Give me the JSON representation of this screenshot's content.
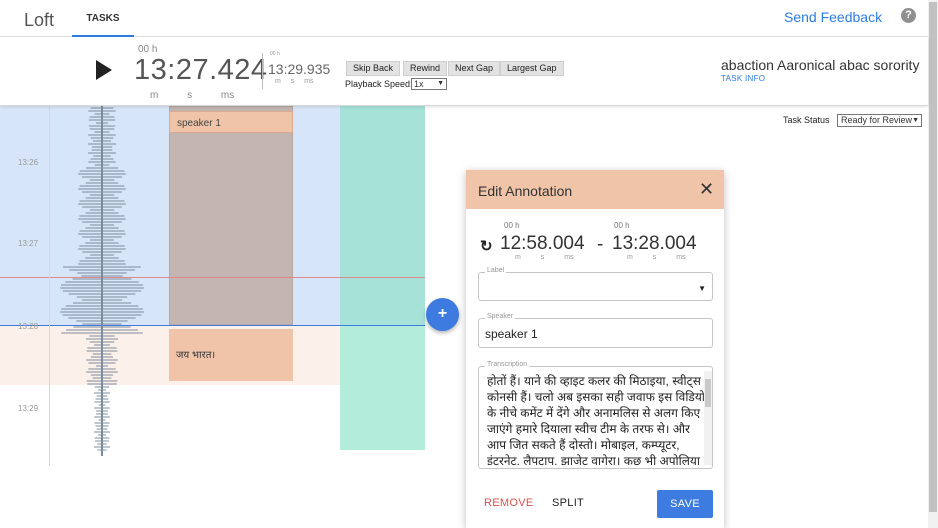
{
  "app": {
    "brand": "Loft",
    "tab_tasks": "TASKS",
    "feedback": "Send Feedback",
    "help_icon": "?"
  },
  "player": {
    "current": {
      "hours": "00 h",
      "time": "13:27.424",
      "units": "m s ms"
    },
    "total": {
      "hours": "00 h",
      "time": "13:29.935",
      "units": "m s ms"
    },
    "buttons": [
      "Skip Back",
      "Rewind",
      "Next Gap",
      "Largest Gap"
    ],
    "speed_label": "Playback Speed:",
    "speed_value": "1x"
  },
  "task": {
    "title": "abaction Aaronical abac sorority",
    "info": "TASK INFO",
    "status_label": "Task Status",
    "status_value": "Ready for Review"
  },
  "timeline": {
    "ticks": [
      "13:26",
      "13:27",
      "13:28",
      "13:29"
    ],
    "segments": [
      {
        "speaker": "speaker 1",
        "text": ""
      },
      {
        "speaker": "",
        "text": "जय भारत।"
      }
    ]
  },
  "dialog": {
    "title": "Edit Annotation",
    "start": {
      "hours": "00 h",
      "time": "12:58.004",
      "units": "m s ms"
    },
    "end": {
      "hours": "00 h",
      "time": "13:28.004",
      "units": "m s ms"
    },
    "label_legend": "Label",
    "label_value": "",
    "speaker_legend": "Speaker",
    "speaker_value": "speaker 1",
    "transcription_legend": "Transcription",
    "transcription": "होतों हैं। याने की व्हाइट कलर की मिठाइया, स्वीट्स कोनसी हैं। चलो अब इसका सही जवाफ इस विडियो के नीचे कमेंट में देंगे और अनामलिस से अलग किए जाएंगे हमारे दियाला स्वीच टीम के तरफ से। और आप जित सकते हैं दोस्तो। मोबाइल, कम्प्यूटर, इंटरनेट, लैपटाप, झाजेट वागेरा। कुछ भी अपोलिया और पराग्राउस गिफ्ट जो की गितअने के",
    "remove": "REMOVE",
    "split": "SPLIT",
    "save": "SAVE"
  },
  "colors": {
    "accent": "#3d7be0",
    "segment": "#efc4a8",
    "teal": "#a8e6d9",
    "selection": "#d6e6f8"
  }
}
